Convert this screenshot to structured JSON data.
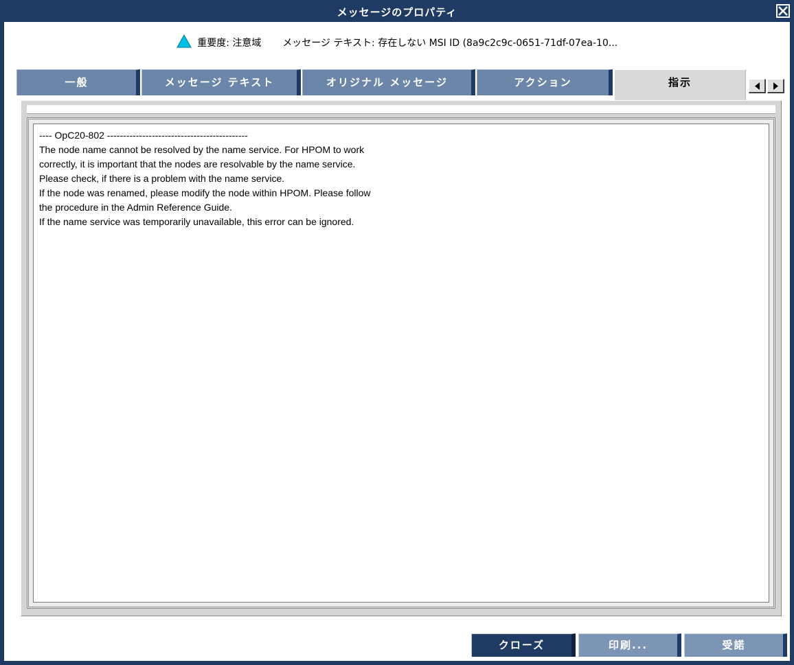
{
  "window": {
    "title": "メッセージのプロパティ",
    "close_icon": "close-icon"
  },
  "header": {
    "severity_icon": "warning-triangle-icon",
    "severity_color": "#00c0e8",
    "severity_text": "重要度: 注意域",
    "message_text": "メッセージ テキスト: 存在しない MSI ID (8a9c2c9c-0651-71df-07ea-10..."
  },
  "tabs": [
    {
      "label": "一般",
      "active": false
    },
    {
      "label": "メッセージ テキスト",
      "active": false
    },
    {
      "label": "オリジナル メッセージ",
      "active": false
    },
    {
      "label": "アクション",
      "active": false
    },
    {
      "label": "指示",
      "active": true
    }
  ],
  "tab_scroll": {
    "left_icon": "arrow-left-icon",
    "right_icon": "arrow-right-icon"
  },
  "instructions": {
    "lines": [
      "---- OpC20-802 --------------------------------------------",
      "The node name cannot be resolved by the name service. For HPOM to work",
      "correctly, it is important that the nodes are resolvable by the name service.",
      "Please check, if there is a problem with the name service.",
      "If the node was renamed, please modify the node within HPOM. Please follow",
      "the procedure in the Admin Reference Guide.",
      "If the name service was temporarily unavailable, this error can be ignored."
    ]
  },
  "buttons": {
    "close": "クローズ",
    "print": "印刷...",
    "acknowledge": "受諾"
  },
  "colors": {
    "title_bar": "#1f3b63",
    "tab_inactive": "#6b86a8",
    "tab_active": "#d9d9d9",
    "button_primary": "#1f3b63",
    "button_secondary": "#7d95b4"
  }
}
